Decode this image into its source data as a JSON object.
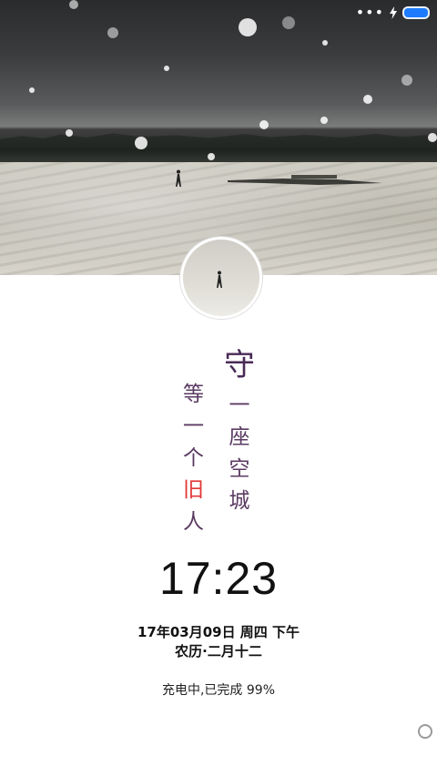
{
  "status_bar": {
    "overflow_dots": "•••",
    "icons": [
      "more-dots-icon",
      "charging-bolt-icon",
      "battery-icon"
    ],
    "battery_color": "#1d7bff"
  },
  "wallpaper": {
    "scene": "snow-field"
  },
  "poem": {
    "right_column": [
      "守",
      "一",
      "座",
      "空",
      "城"
    ],
    "left_column": [
      "等",
      "一",
      "个",
      "旧",
      "人"
    ],
    "highlight_char_color": "#e23838",
    "text_color": "#5b3b63"
  },
  "lockscreen": {
    "time": "17:23",
    "date_line": "17年03月09日 周四 下午",
    "lunar_line": "农历·二月十二",
    "charging_status": "充电中,已完成 99%"
  }
}
